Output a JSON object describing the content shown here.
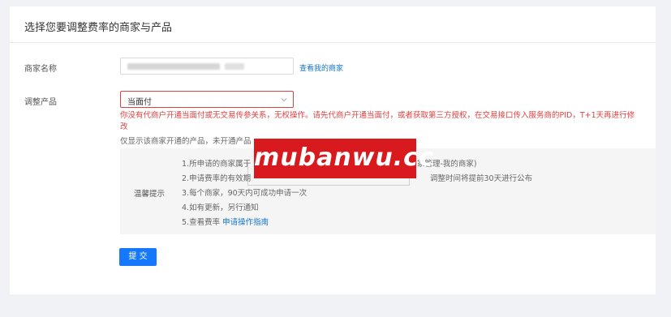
{
  "card": {
    "title": "选择您要调整费率的商家与产品"
  },
  "form": {
    "merchant_label": "商家名称",
    "view_merchants_link": "查看我的商家",
    "product_label": "调整产品",
    "product_value": "当面付",
    "error_message": "你没有代商户开通当面付或无交易传参关系，无权操作。请先代商户开通当面付，或者获取第三方授权，在交易接口传入服务商的PID，T+1天再进行修改",
    "hint_text": "仅显示该商家开通的产品，未开通产品"
  },
  "tips": {
    "label": "温馨提示",
    "items": [
      "1.所申请的商家属于",
      "2.申请费率的有效期",
      "3.每个商家，90天内可成功申请一次",
      "4.如有更新，另行通知",
      "5.查看费率"
    ],
    "tail_1": "家管理-我的商家)",
    "tail_2": "调整时间将提前30天进行公布",
    "guide_link": "申请操作指南"
  },
  "actions": {
    "submit_label": "提 交"
  },
  "watermark": {
    "text": "mubanwu.cc"
  },
  "colors": {
    "primary": "#1677ff",
    "link": "#1677cc",
    "error": "#e04040",
    "watermark": "#d8191d"
  }
}
